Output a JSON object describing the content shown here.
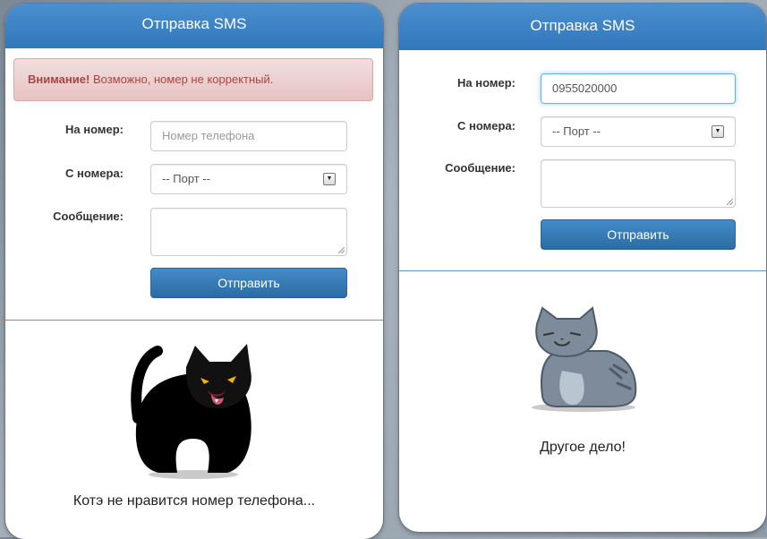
{
  "left_panel": {
    "title": "Отправка SMS",
    "alert": {
      "strong": "Внимание!",
      "text": "Возможно, номер не корректный."
    },
    "form": {
      "to_label": "На номер:",
      "to_placeholder": "Номер телефона",
      "from_label": "С номера:",
      "from_selected": "-- Порт --",
      "message_label": "Сообщение:",
      "submit_label": "Отправить"
    },
    "caption": "Котэ не нравится номер телефона..."
  },
  "right_panel": {
    "title": "Отправка SMS",
    "form": {
      "to_label": "На номер:",
      "to_value": "0955020000",
      "from_label": "С номера:",
      "from_selected": "-- Порт --",
      "message_label": "Сообщение:",
      "submit_label": "Отправить"
    },
    "caption": "Другое дело!"
  },
  "colors": {
    "header_blue": "#3a7fc1",
    "alert_text": "#a94442",
    "alert_bg": "#f2dede",
    "button_blue": "#3579b8"
  },
  "icons": [
    "angry-black-cat-icon",
    "calm-gray-cat-icon",
    "select-arrow-icon"
  ]
}
